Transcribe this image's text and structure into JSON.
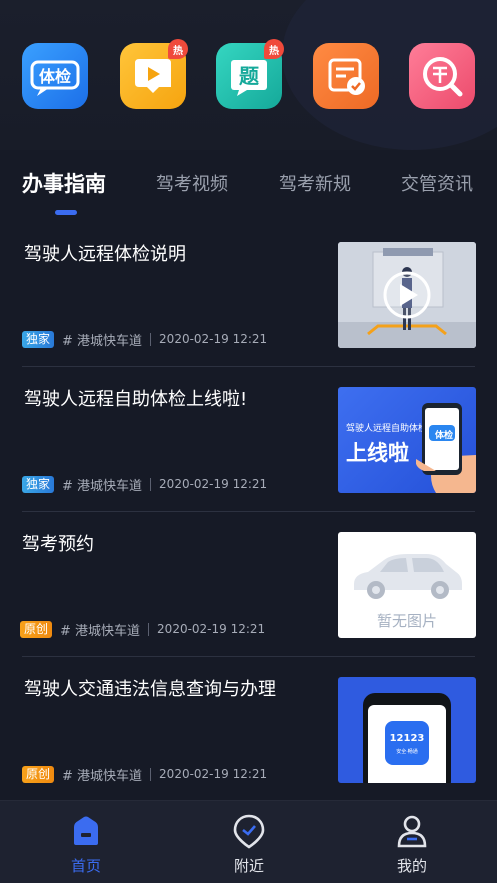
{
  "quick_icons": [
    {
      "name": "体检",
      "icon": "health-check-icon",
      "color": "#2a86f0"
    },
    {
      "name": "video",
      "icon": "video-play-icon",
      "color": "#f9b51d",
      "badge": "热"
    },
    {
      "name": "题",
      "icon": "exam-question-icon",
      "color": "#21c2b2",
      "badge": "热"
    },
    {
      "name": "form",
      "icon": "form-check-icon",
      "color": "#f47b34"
    },
    {
      "name": "fine",
      "icon": "fine-search-icon",
      "color": "#f15a7c"
    }
  ],
  "tabs": [
    "办事指南",
    "驾考视频",
    "驾考新规",
    "交管资讯"
  ],
  "articles": [
    {
      "title": "驾驶人远程体检说明",
      "badge": "独家",
      "source": "# 港城快车道",
      "date": "2020-02-19 12:21"
    },
    {
      "title": "驾驶人远程自助体检上线啦!",
      "badge": "独家",
      "source": "# 港城快车道",
      "date": "2020-02-19 12:21",
      "thumb_title": "驾驶人远程自助体检",
      "thumb_big": "上线啦",
      "thumb_badge": "体检"
    },
    {
      "title": "驾考预约",
      "badge": "原创",
      "source": "# 港城快车道",
      "date": "2020-02-19 12:21",
      "thumb_text": "暂无图片"
    },
    {
      "title": "驾驶人交通违法信息查询与办理",
      "badge": "原创",
      "source": "# 港城快车道",
      "date": "2020-02-19 12:21",
      "thumb_app": "12123",
      "thumb_slogan": "安全·畅通"
    }
  ],
  "bottom_nav": [
    "首页",
    "附近",
    "我的"
  ],
  "colors": {
    "accent": "#3b6cf0",
    "background": "#161a26"
  }
}
